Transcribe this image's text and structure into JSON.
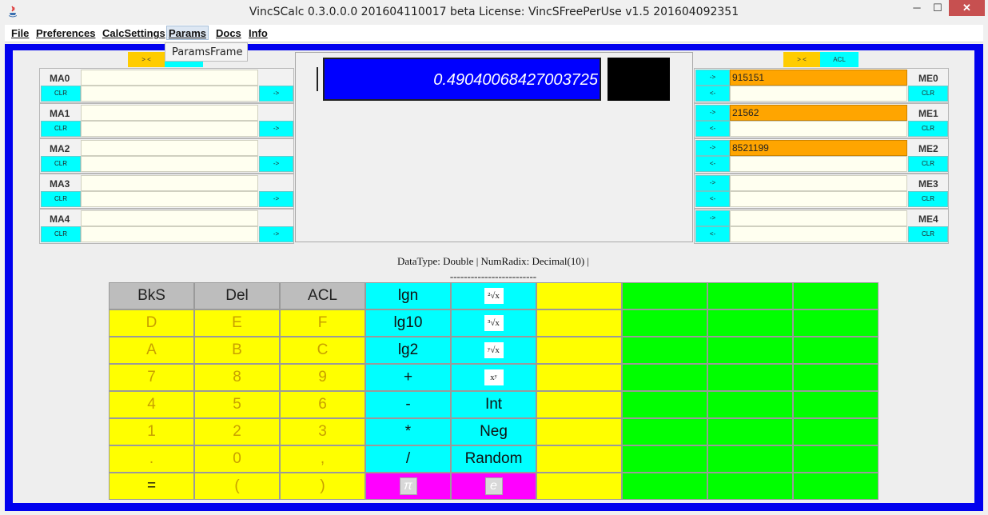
{
  "window": {
    "title": "VincSCalc 0.3.0.0.0 201604110017 beta     License: VincSFreePerUse v1.5 201604092351",
    "minimize": "─",
    "maximize": "☐",
    "close": "✕"
  },
  "menu": {
    "items": [
      "File",
      "Preferences",
      "CalcSettings",
      "Params",
      "Docs",
      "Info"
    ],
    "open_menu": "Params",
    "dropdown_items": [
      "ParamsFrame"
    ]
  },
  "left_panel": {
    "swap_button": "> <",
    "rows": [
      {
        "label": "MA0",
        "value": "",
        "clear": "CLR",
        "send": "->"
      },
      {
        "label": "MA1",
        "value": "",
        "clear": "CLR",
        "send": "->"
      },
      {
        "label": "MA2",
        "value": "",
        "clear": "CLR",
        "send": "->"
      },
      {
        "label": "MA3",
        "value": "",
        "clear": "CLR",
        "send": "->"
      },
      {
        "label": "MA4",
        "value": "",
        "clear": "CLR",
        "send": "->"
      }
    ]
  },
  "right_panel": {
    "swap_button": "> <",
    "acl_button": "ACL",
    "rows": [
      {
        "label": "ME0",
        "value": "915151",
        "clear": "CLR",
        "load": "->",
        "recall": "<-"
      },
      {
        "label": "ME1",
        "value": "21562",
        "clear": "CLR",
        "load": "->",
        "recall": "<-"
      },
      {
        "label": "ME2",
        "value": "8521199",
        "clear": "CLR",
        "load": "->",
        "recall": "<-"
      },
      {
        "label": "ME3",
        "value": "",
        "clear": "CLR",
        "load": "->",
        "recall": "<-"
      },
      {
        "label": "ME4",
        "value": "",
        "clear": "CLR",
        "load": "->",
        "recall": "<-"
      }
    ]
  },
  "display": {
    "value": "0.49040068427003725"
  },
  "status": {
    "datatype_line": "DataType: Double | NumRadix: Decimal(10) |",
    "separator": "-------------------------"
  },
  "keypad": {
    "rows": [
      [
        "BkS",
        "Del",
        "ACL",
        "lgn",
        "²√x",
        "",
        "",
        "",
        ""
      ],
      [
        "D",
        "E",
        "F",
        "lg10",
        "³√x",
        "",
        "",
        "",
        ""
      ],
      [
        "A",
        "B",
        "C",
        "lg2",
        "ʸ√x",
        "",
        "",
        "",
        ""
      ],
      [
        "7",
        "8",
        "9",
        "+",
        "xʸ",
        "",
        "",
        "",
        ""
      ],
      [
        "4",
        "5",
        "6",
        "-",
        "Int",
        "",
        "",
        "",
        ""
      ],
      [
        "1",
        "2",
        "3",
        "*",
        "Neg",
        "",
        "",
        "",
        ""
      ],
      [
        ".",
        "0",
        ",",
        "/",
        "Random",
        "",
        "",
        "",
        ""
      ],
      [
        "=",
        "(",
        ")",
        "π",
        "e",
        "",
        "",
        "",
        ""
      ]
    ]
  },
  "colors": {
    "frame": "#0000ee",
    "display_bg": "#0000ff",
    "memory_filled": "#ffa500",
    "key_yellow": "#ffff00",
    "key_cyan": "#00ffff",
    "key_magenta": "#ff00ff",
    "key_green": "#00ff00",
    "key_gray": "#bdbdbd"
  }
}
